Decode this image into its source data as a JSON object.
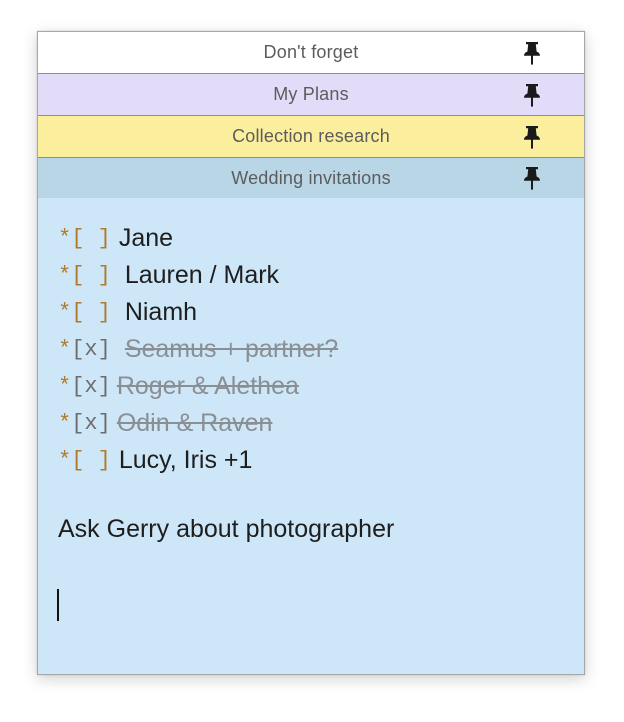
{
  "tabs": [
    {
      "title": "Don't forget",
      "bg": "#ffffff",
      "pin_icon": "pushpin-icon"
    },
    {
      "title": "My Plans",
      "bg": "#e3dcf9",
      "pin_icon": "pushpin-icon"
    },
    {
      "title": "Collection research",
      "bg": "#fbef9d",
      "pin_icon": "pushpin-icon"
    },
    {
      "title": "Wedding invitations",
      "bg": "#b9d6e7",
      "pin_icon": "pushpin-icon"
    }
  ],
  "note": {
    "todos": [
      {
        "star": "*",
        "box": "[ ]",
        "text": "Jane",
        "done": false
      },
      {
        "star": "*",
        "box": "[ ]",
        "text": "Lauren / Mark",
        "done": false
      },
      {
        "star": "*",
        "box": "[ ]",
        "text": "Niamh",
        "done": false
      },
      {
        "star": "*",
        "box": "[x]",
        "text": "Seamus + partner?",
        "done": true
      },
      {
        "star": "*",
        "box": "[x]",
        "text": "Roger & Alethea",
        "done": true
      },
      {
        "star": "*",
        "box": "[x]",
        "text": "Odin & Raven",
        "done": true
      },
      {
        "star": "*",
        "box": "[ ]",
        "text": "Lucy, Iris +1",
        "done": false
      }
    ],
    "reminder": "Ask Gerry about photographer",
    "background": "#cde7f8",
    "checkbox_color": "#b07a2a",
    "done_color": "#8a8f94"
  }
}
